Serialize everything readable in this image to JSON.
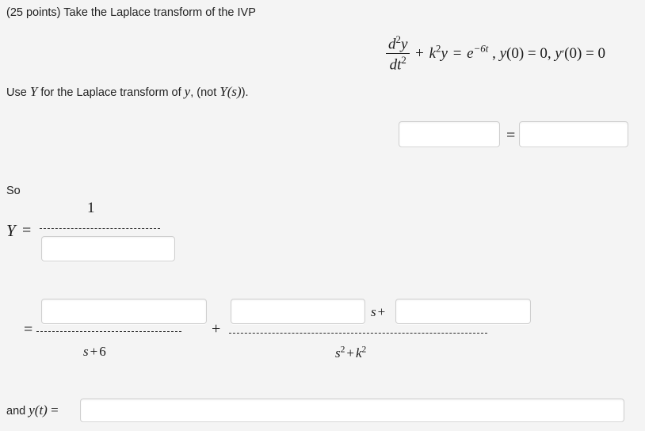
{
  "problem": {
    "prompt_line": "(25 points) Take the Laplace transform of the IVP",
    "points_label": "25 points",
    "instruction_prefix": "Use ",
    "instruction_Y": "Y",
    "instruction_middle": " for the Laplace transform of ",
    "instruction_y": "y",
    "instruction_paren_open": ", (not ",
    "instruction_Ys": "Y(s)",
    "instruction_suffix": ").",
    "so_label": "So",
    "and_label": "and ",
    "and_yt": "y(t)",
    "and_equals": " ="
  },
  "equation": {
    "frac_numerator": "d²y",
    "frac_denominator": "dt²",
    "plus": "+",
    "k_term": "k²y",
    "equals": "=",
    "rhs_base": "e",
    "rhs_exponent": "−6t",
    "initial_conditions": ", y(0) = 0, y′(0) = 0",
    "full_text": "d²y/dt² + k²y = e^(-6t), y(0) = 0, y'(0) = 0"
  },
  "transform_row": {
    "left_input": {
      "value": "",
      "placeholder": ""
    },
    "equals_symbol": "=",
    "right_input": {
      "value": "",
      "placeholder": ""
    }
  },
  "Y_expression": {
    "label": "Y",
    "equals_symbol": "=",
    "numerator": "1",
    "denominator_input": {
      "value": "",
      "placeholder": ""
    }
  },
  "partial_fractions": {
    "equals_symbol": "=",
    "plus_symbol": "+",
    "term1": {
      "numerator_input": {
        "value": "",
        "placeholder": ""
      },
      "denominator": "s + 6"
    },
    "term2": {
      "numerator_input_left": {
        "value": "",
        "placeholder": ""
      },
      "numerator_middle_text": "s+",
      "numerator_input_right": {
        "value": "",
        "placeholder": ""
      },
      "denominator": "s² + k²"
    }
  },
  "solution_row": {
    "label": "and y(t) =",
    "input": {
      "value": "",
      "placeholder": ""
    }
  },
  "colors": {
    "page_background": "#f4f4f4",
    "input_background": "#ffffff",
    "input_border": "#cfcfcf",
    "text": "#222222",
    "math_text": "#1a1a1a"
  }
}
